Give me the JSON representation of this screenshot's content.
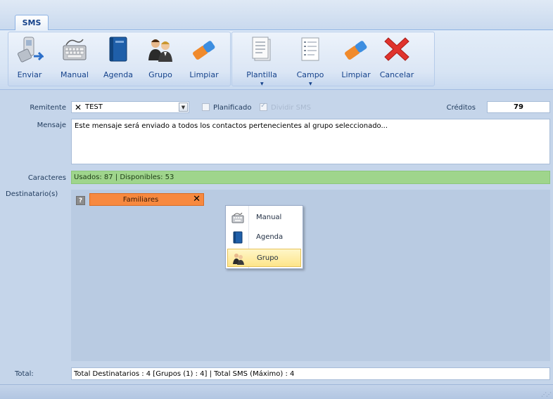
{
  "ribbon": {
    "tab_label": "SMS",
    "group1": [
      {
        "label": "Enviar",
        "icon": "send-phone-icon"
      },
      {
        "label": "Manual",
        "icon": "keyboard-icon"
      },
      {
        "label": "Agenda",
        "icon": "address-book-icon"
      },
      {
        "label": "Grupo",
        "icon": "group-icon"
      },
      {
        "label": "Limpiar",
        "icon": "eraser-icon"
      }
    ],
    "group2": [
      {
        "label": "Plantilla",
        "icon": "template-icon"
      },
      {
        "label": "Campo",
        "icon": "field-icon"
      },
      {
        "label": "Limpiar",
        "icon": "eraser-icon"
      },
      {
        "label": "Cancelar",
        "icon": "cancel-icon"
      }
    ]
  },
  "form": {
    "remitente_label": "Remitente",
    "remitente_value": "TEST",
    "remitente_mark": "✕",
    "planificado_label": "Planificado",
    "dividir_label": "Dividir SMS",
    "creditos_label": "Créditos",
    "creditos_value": "79",
    "mensaje_label": "Mensaje",
    "mensaje_value": "Este mensaje será enviado a todos los contactos pertenecientes al grupo seleccionado...",
    "caracteres_label": "Caracteres",
    "caracteres_value": "Usados: 87 | Disponibles: 53",
    "destinatarios_label": "Destinatario(s)",
    "help_glyph": "?",
    "recipient_tag": "Familiares",
    "recipient_remove": "✕",
    "total_label": "Total:",
    "total_value": "Total Destinatarios : 4   [Grupos (1) : 4] | Total SMS (Máximo) : 4"
  },
  "context_menu": {
    "items": [
      {
        "label": "Manual",
        "icon": "keyboard-icon",
        "selected": false
      },
      {
        "label": "Agenda",
        "icon": "address-book-icon",
        "selected": false
      },
      {
        "label": "Grupo",
        "icon": "group-icon",
        "selected": true
      }
    ]
  },
  "colors": {
    "ribbon_bg": "#d7e4f4",
    "usage_bar": "#9fd58c",
    "tag": "#f7893f",
    "menu_highlight": "#fde58a"
  }
}
